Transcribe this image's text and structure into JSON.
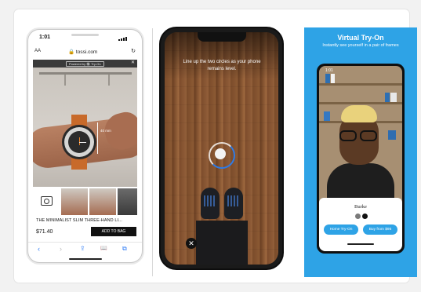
{
  "colors": {
    "accent_blue": "#2ea3e6",
    "ios_blue": "#2f7cf6",
    "ring_blue": "#2e7be6"
  },
  "phone1": {
    "time": "1:01",
    "aa_label": "AA",
    "url": "🔒 tossi.com",
    "reload_icon": "↻",
    "banner_text": "Powered by 🔘 Try-On",
    "banner_close": "✕",
    "measurement": "40 mm",
    "product_title": "THE MINIMALIST SLIM THREE-HAND LI...",
    "price": "$71.40",
    "add_to_bag": "ADD TO BAG",
    "toolbar": {
      "back": "‹",
      "forward": "›",
      "share": "⇪",
      "bookmarks": "📖",
      "tabs": "⧉"
    }
  },
  "phone2": {
    "instruction": "Line up the two circles as your phone remains level.",
    "close_label": "✕"
  },
  "phone3": {
    "heading": "Virtual Try-On",
    "subheading": "Instantly see yourself in a pair of frames",
    "time": "1:01",
    "frame_name": "Burke",
    "home_try_on": "Home Try-On",
    "buy": "Buy from $95"
  }
}
